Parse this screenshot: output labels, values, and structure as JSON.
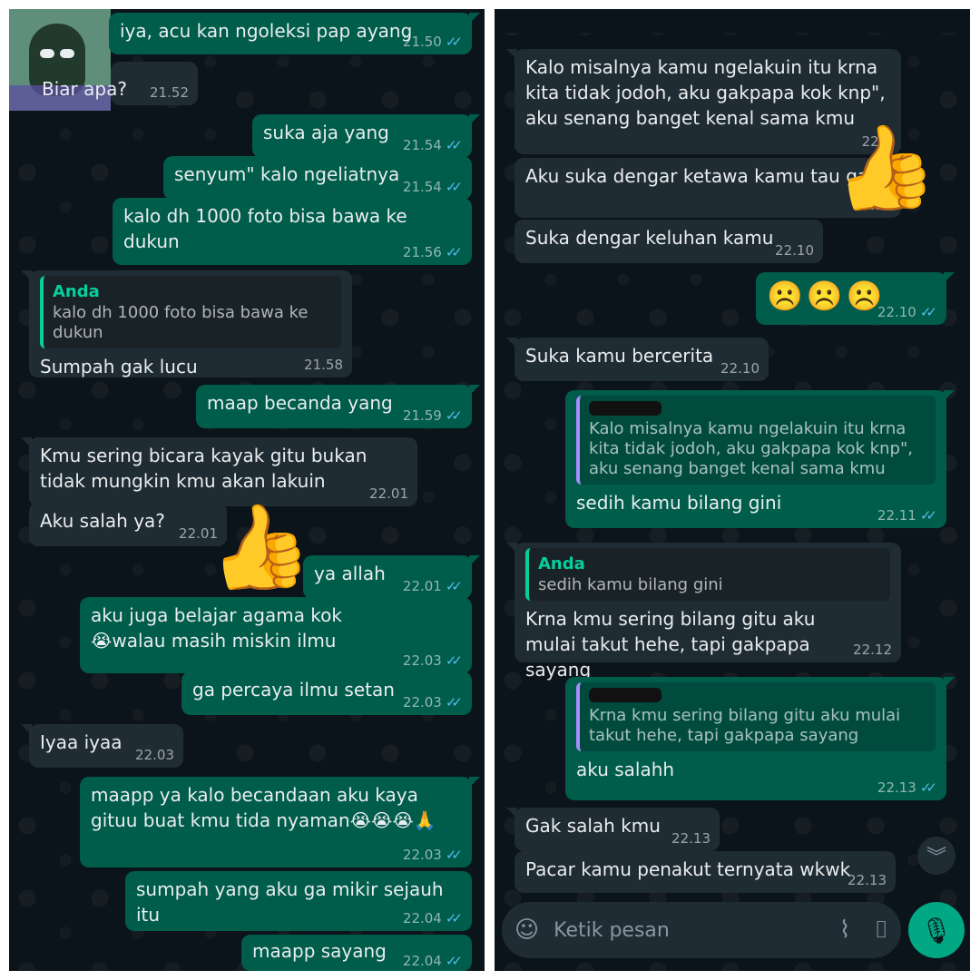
{
  "left": {
    "sticker_text": "Biar apa?",
    "messages": [
      {
        "text": "iya, acu kan ngoleksi pap ayang",
        "time": "21.50"
      },
      {
        "text": "",
        "time": "21.52"
      },
      {
        "text": "suka aja yang",
        "time": "21.54"
      },
      {
        "text": "senyum\" kalo ngeliatnya",
        "time": "21.54"
      },
      {
        "text": "kalo dh 1000 foto bisa bawa ke dukun",
        "time": "21.56"
      },
      {
        "quote_author": "Anda",
        "quote_text": "kalo dh 1000 foto bisa bawa ke dukun",
        "text": "Sumpah gak lucu",
        "time": "21.58"
      },
      {
        "text": "maap becanda yang",
        "time": "21.59"
      },
      {
        "text": "Kmu sering bicara kayak gitu bukan tidak mungkin kmu akan lakuin",
        "time": "22.01"
      },
      {
        "text": "Aku salah ya?",
        "time": "22.01"
      },
      {
        "text": "ya allah",
        "time": "22.01"
      },
      {
        "text": "aku juga belajar agama kok😭walau masih miskin ilmu",
        "time": "22.03"
      },
      {
        "text": "ga percaya ilmu setan",
        "time": "22.03"
      },
      {
        "text": "Iyaa iyaa",
        "time": "22.03"
      },
      {
        "text": "maapp ya kalo becandaan aku kaya gituu buat kmu tida nyaman😭😭😭🙏",
        "time": "22.03"
      },
      {
        "text": "sumpah yang aku ga mikir sejauh itu",
        "time": "22.04"
      },
      {
        "text": "maapp sayang",
        "time": "22.04"
      }
    ],
    "thumb_emoji": "👍"
  },
  "right": {
    "messages": [
      {
        "text": "Kalo misalnya kamu ngelakuin itu krna kita tidak jodoh, aku gakpapa kok knp\", aku senang banget kenal sama kmu",
        "time": "22.1"
      },
      {
        "text": "Aku suka dengar ketawa kamu tau gak",
        "time": "22.10"
      },
      {
        "text": "Suka dengar keluhan kamu",
        "time": "22.10"
      },
      {
        "text": "☹️☹️☹️",
        "time": "22.10"
      },
      {
        "text": "Suka kamu bercerita",
        "time": "22.10"
      },
      {
        "quote_text": "Kalo misalnya kamu ngelakuin itu krna kita tidak jodoh, aku gakpapa kok knp\", aku senang banget kenal sama kmu",
        "text": "sedih kamu bilang gini",
        "time": "22.11"
      },
      {
        "quote_author": "Anda",
        "quote_text": "sedih kamu bilang gini",
        "text": "Krna kmu sering bilang gitu aku mulai takut hehe, tapi gakpapa sayang",
        "time": "22.12"
      },
      {
        "quote_text": "Krna kmu sering bilang gitu aku mulai takut hehe, tapi gakpapa sayang",
        "text": "aku salahh",
        "time": "22.13"
      },
      {
        "text": "Gak salah kmu",
        "time": "22.13"
      },
      {
        "text": "Pacar kamu penakut ternyata wkwk",
        "time": "22.13"
      }
    ],
    "thumb_emoji": "👍",
    "composer": {
      "placeholder": "Ketik pesan"
    },
    "icons": {
      "sticker": "sticker-icon",
      "attach": "paperclip-icon",
      "camera": "camera-icon",
      "mic": "microphone-icon",
      "scroll": "scroll-down-icon"
    }
  },
  "colors": {
    "outgoing": "#005c4b",
    "incoming": "#202c33",
    "background": "#0b141a",
    "read_ticks": "#53bdeb",
    "accent": "#00a884"
  }
}
